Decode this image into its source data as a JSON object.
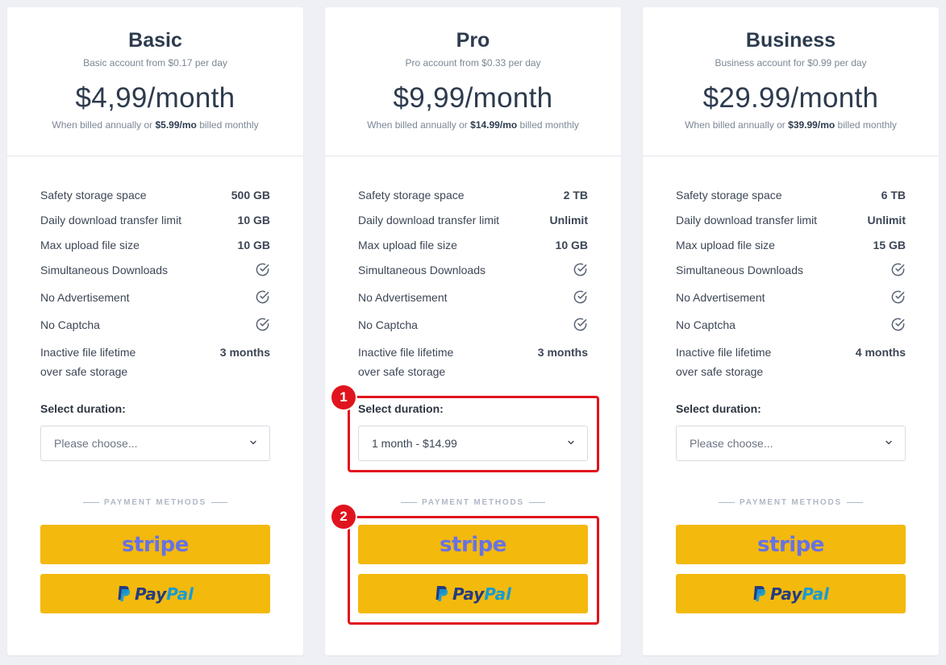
{
  "plans": [
    {
      "name": "Basic",
      "subtitle": "Basic account from $0.17 per day",
      "price": "$4,99/month",
      "billing_prefix": "When billed annually or",
      "billing_monthly": "$5.99/mo",
      "billing_suffix": "billed monthly",
      "features": [
        {
          "label": "Safety storage space",
          "value": "500 GB"
        },
        {
          "label": "Daily download transfer limit",
          "value": "10 GB"
        },
        {
          "label": "Max upload file size",
          "value": "10 GB"
        },
        {
          "label": "Simultaneous Downloads",
          "icon": "check-circle-icon"
        },
        {
          "label": "No Advertisement",
          "icon": "check-circle-icon"
        },
        {
          "label": "No Captcha",
          "icon": "check-circle-icon"
        }
      ],
      "lifetime_label_1": "Inactive file lifetime",
      "lifetime_label_2": "over safe storage",
      "lifetime_value": "3 months",
      "duration_label": "Select duration:",
      "duration_value": "Please choose...",
      "payment_label": "PAYMENT METHODS",
      "stripe_label": "stripe",
      "paypal_label_1": "Pay",
      "paypal_label_2": "Pal"
    },
    {
      "name": "Pro",
      "subtitle": "Pro account from $0.33 per day",
      "price": "$9,99/month",
      "billing_prefix": "When billed annually or",
      "billing_monthly": "$14.99/mo",
      "billing_suffix": "billed monthly",
      "features": [
        {
          "label": "Safety storage space",
          "value": "2 TB"
        },
        {
          "label": "Daily download transfer limit",
          "value": "Unlimit"
        },
        {
          "label": "Max upload file size",
          "value": "10 GB"
        },
        {
          "label": "Simultaneous Downloads",
          "icon": "check-circle-icon"
        },
        {
          "label": "No Advertisement",
          "icon": "check-circle-icon"
        },
        {
          "label": "No Captcha",
          "icon": "check-circle-icon"
        }
      ],
      "lifetime_label_1": "Inactive file lifetime",
      "lifetime_label_2": "over safe storage",
      "lifetime_value": "3 months",
      "duration_label": "Select duration:",
      "duration_value": "1 month - $14.99",
      "payment_label": "PAYMENT METHODS",
      "stripe_label": "stripe",
      "paypal_label_1": "Pay",
      "paypal_label_2": "Pal"
    },
    {
      "name": "Business",
      "subtitle": "Business account for $0.99 per day",
      "price": "$29.99/month",
      "billing_prefix": "When billed annually or",
      "billing_monthly": "$39.99/mo",
      "billing_suffix": "billed monthly",
      "features": [
        {
          "label": "Safety storage space",
          "value": "6 TB"
        },
        {
          "label": "Daily download transfer limit",
          "value": "Unlimit"
        },
        {
          "label": "Max upload file size",
          "value": "15 GB"
        },
        {
          "label": "Simultaneous Downloads",
          "icon": "check-circle-icon"
        },
        {
          "label": "No Advertisement",
          "icon": "check-circle-icon"
        },
        {
          "label": "No Captcha",
          "icon": "check-circle-icon"
        }
      ],
      "lifetime_label_1": "Inactive file lifetime",
      "lifetime_label_2": "over safe storage",
      "lifetime_value": "4 months",
      "duration_label": "Select duration:",
      "duration_value": "Please choose...",
      "payment_label": "PAYMENT METHODS",
      "stripe_label": "stripe",
      "paypal_label_1": "Pay",
      "paypal_label_2": "Pal"
    }
  ],
  "annotations": [
    {
      "number": "1"
    },
    {
      "number": "2"
    }
  ],
  "colors": {
    "accent_button": "#f3b90d",
    "stripe": "#6772e5",
    "annotation": "#e0141e",
    "paypal_dark": "#253b80",
    "paypal_light": "#179bd7"
  }
}
